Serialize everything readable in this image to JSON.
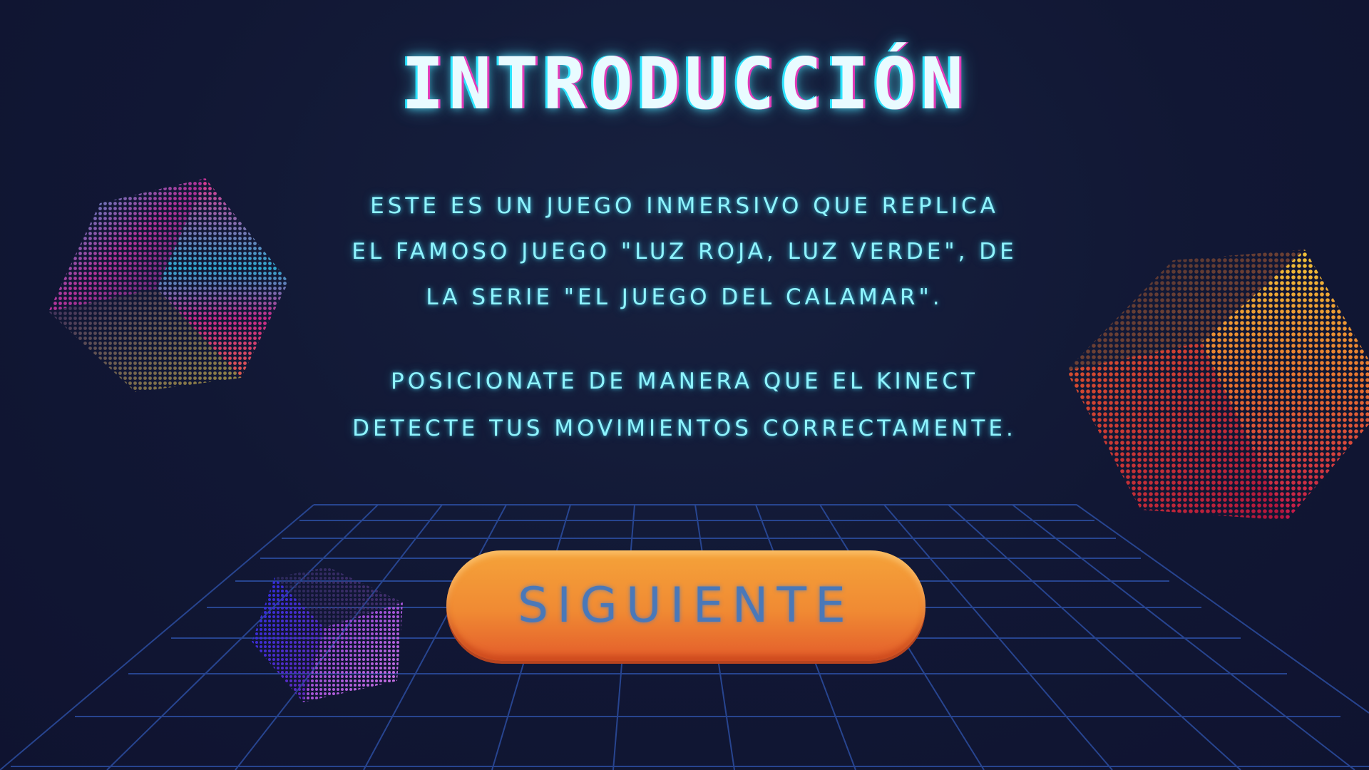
{
  "screen": {
    "title": "INTRODUCCIÓN",
    "intro_paragraph": {
      "lines": [
        "ESTE ES UN JUEGO INMERSIVO QUE REPLICA",
        "EL FAMOSO JUEGO \"LUZ ROJA, LUZ VERDE\", DE",
        "LA SERIE \"EL JUEGO DEL CALAMAR\"."
      ]
    },
    "instruction_paragraph": {
      "lines": [
        "POSICIONATE DE MANERA QUE EL KINECT",
        "DETECTE TUS MOVIMIENTOS CORRECTAMENTE."
      ]
    },
    "next_button": {
      "label": "SIGUIENTE"
    }
  },
  "colors": {
    "background": "#111734",
    "title_glow": "#2de4ff",
    "text": "#8ff4ff",
    "grid": "#2a4a9a",
    "button_top": "#f5a33a",
    "button_bottom": "#e35c2b",
    "button_text": "#4a78b8"
  },
  "decorations": {
    "cubes": [
      "halftone-cube-pink-blue",
      "halftone-cube-orange-red",
      "halftone-cube-blue-purple"
    ],
    "floor": "perspective-grid"
  }
}
